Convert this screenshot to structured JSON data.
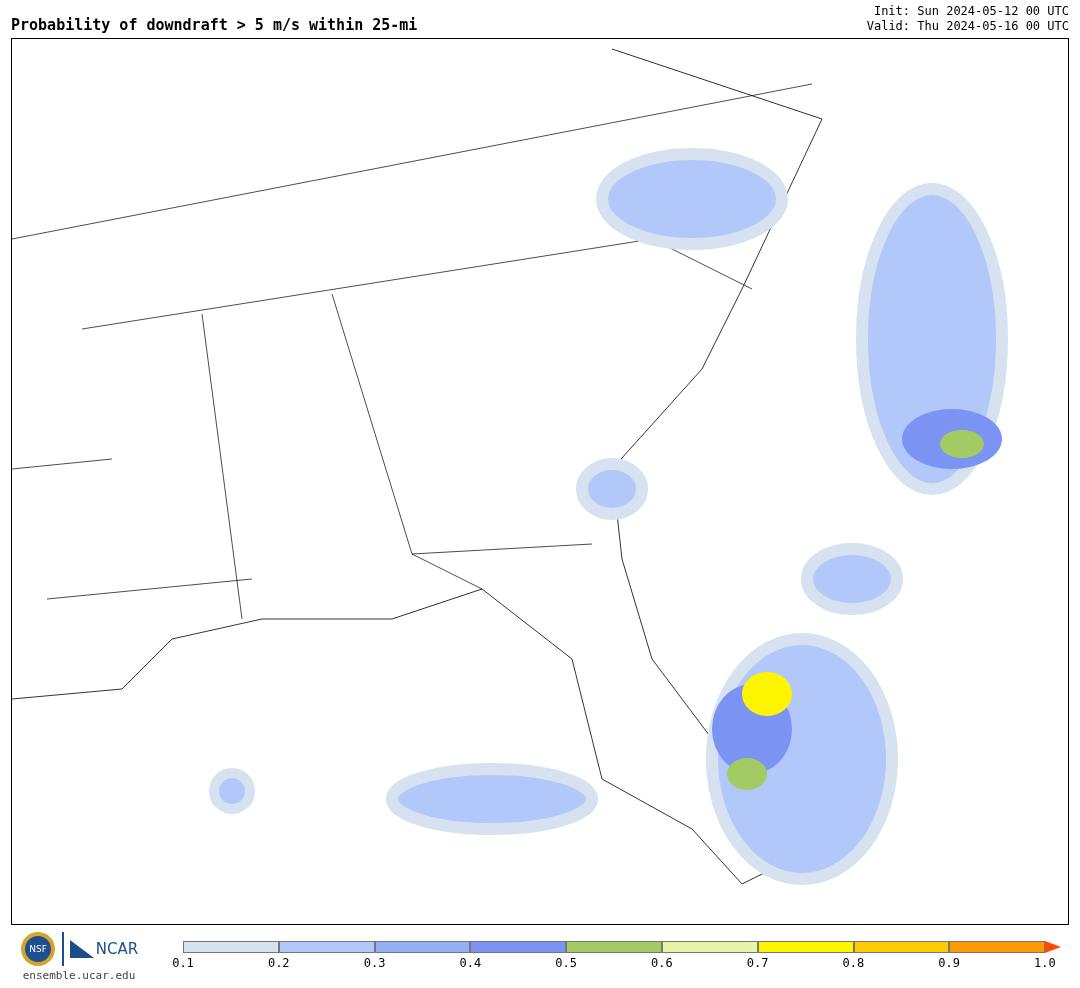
{
  "title": "Probability of downdraft > 5 m/s within 25-mi",
  "init": "Init: Sun 2024-05-12 00 UTC",
  "valid": "Valid: Thu 2024-05-16 00 UTC",
  "logos": {
    "nsf": "NSF",
    "ncar": "NCAR",
    "url": "ensemble.ucar.edu"
  },
  "colorbar": {
    "segments": [
      {
        "color": "#d6e2ef"
      },
      {
        "color": "#b3c8fa"
      },
      {
        "color": "#93b0f5"
      },
      {
        "color": "#7b93f2"
      },
      {
        "color": "#a3cb64"
      },
      {
        "color": "#e6f5a8"
      },
      {
        "color": "#fff500"
      },
      {
        "color": "#ffcc00"
      },
      {
        "color": "#ff9a00"
      },
      {
        "color": "#ff4a00",
        "kind": "arrow"
      }
    ],
    "ticks": [
      "0.1",
      "0.2",
      "0.3",
      "0.4",
      "0.5",
      "0.6",
      "0.7",
      "0.8",
      "0.9",
      "1.0"
    ]
  }
}
